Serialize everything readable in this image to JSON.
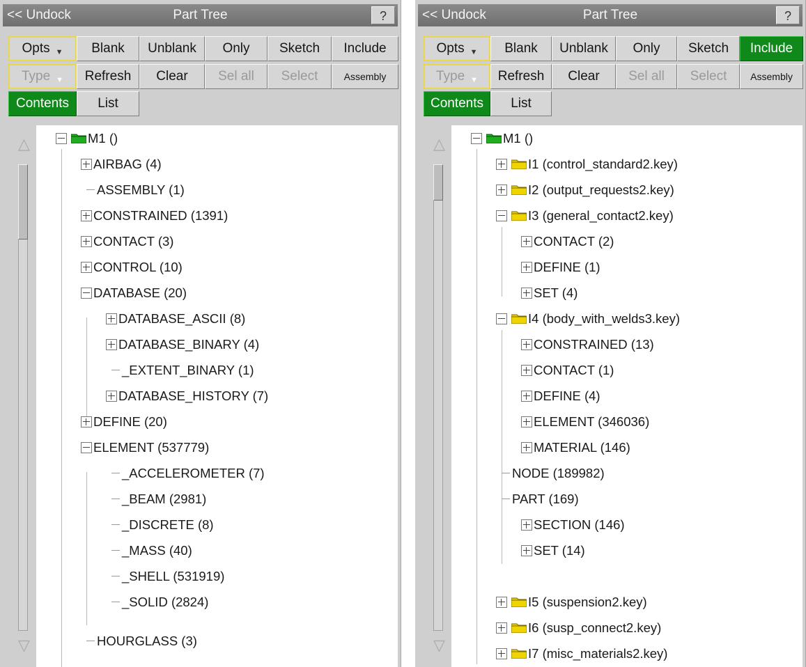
{
  "panels": [
    {
      "titlebar": {
        "undock": "<< Undock",
        "title": "Part Tree",
        "help": "?"
      },
      "toolbar": {
        "opts": "Opts",
        "blank": "Blank",
        "unblank": "Unblank",
        "only": "Only",
        "sketch": "Sketch",
        "include": "Include",
        "type": "Type",
        "refresh": "Refresh",
        "clear": "Clear",
        "sel_all": "Sel all",
        "select": "Select",
        "assembly": "Assembly",
        "contents": "Contents",
        "list": "List"
      },
      "tree": [
        "M1 ()",
        "AIRBAG (4)",
        "ASSEMBLY (1)",
        "CONSTRAINED (1391)",
        "CONTACT (3)",
        "CONTROL (10)",
        "DATABASE (20)",
        "DATABASE_ASCII (8)",
        "DATABASE_BINARY (4)",
        "_EXTENT_BINARY (1)",
        "DATABASE_HISTORY (7)",
        "DEFINE (20)",
        "ELEMENT (537779)",
        "_ACCELEROMETER (7)",
        "_BEAM (2981)",
        "_DISCRETE (8)",
        "_MASS (40)",
        "_SHELL (531919)",
        "_SOLID (2824)",
        "HOURGLASS (3)"
      ]
    },
    {
      "titlebar": {
        "undock": "<< Undock",
        "title": "Part Tree",
        "help": "?"
      },
      "toolbar": {
        "opts": "Opts",
        "blank": "Blank",
        "unblank": "Unblank",
        "only": "Only",
        "sketch": "Sketch",
        "include": "Include",
        "type": "Type",
        "refresh": "Refresh",
        "clear": "Clear",
        "sel_all": "Sel all",
        "select": "Select",
        "assembly": "Assembly",
        "contents": "Contents",
        "list": "List"
      },
      "tree": [
        "M1 ()",
        "I1 (control_standard2.key)",
        "I2 (output_requests2.key)",
        "I3 (general_contact2.key)",
        "CONTACT (2)",
        "DEFINE (1)",
        "SET (4)",
        "I4 (body_with_welds3.key)",
        "CONSTRAINED (13)",
        "CONTACT (1)",
        "DEFINE (4)",
        "ELEMENT (346036)",
        "MATERIAL (146)",
        "NODE (189982)",
        "PART (169)",
        "SECTION (146)",
        "SET (14)",
        "I5 (suspension2.key)",
        "I6 (susp_connect2.key)",
        "I7 (misc_materials2.key)"
      ]
    }
  ],
  "colors": {
    "active_green": "#0f8a1a",
    "model_folder": "#1fae1f",
    "include_folder": "#f0d400",
    "panel_bg": "#cfcfcf"
  },
  "icons": {
    "model": "folder-icon",
    "include": "folder-icon",
    "expand": "expand-icon",
    "collapse": "collapse-icon"
  }
}
